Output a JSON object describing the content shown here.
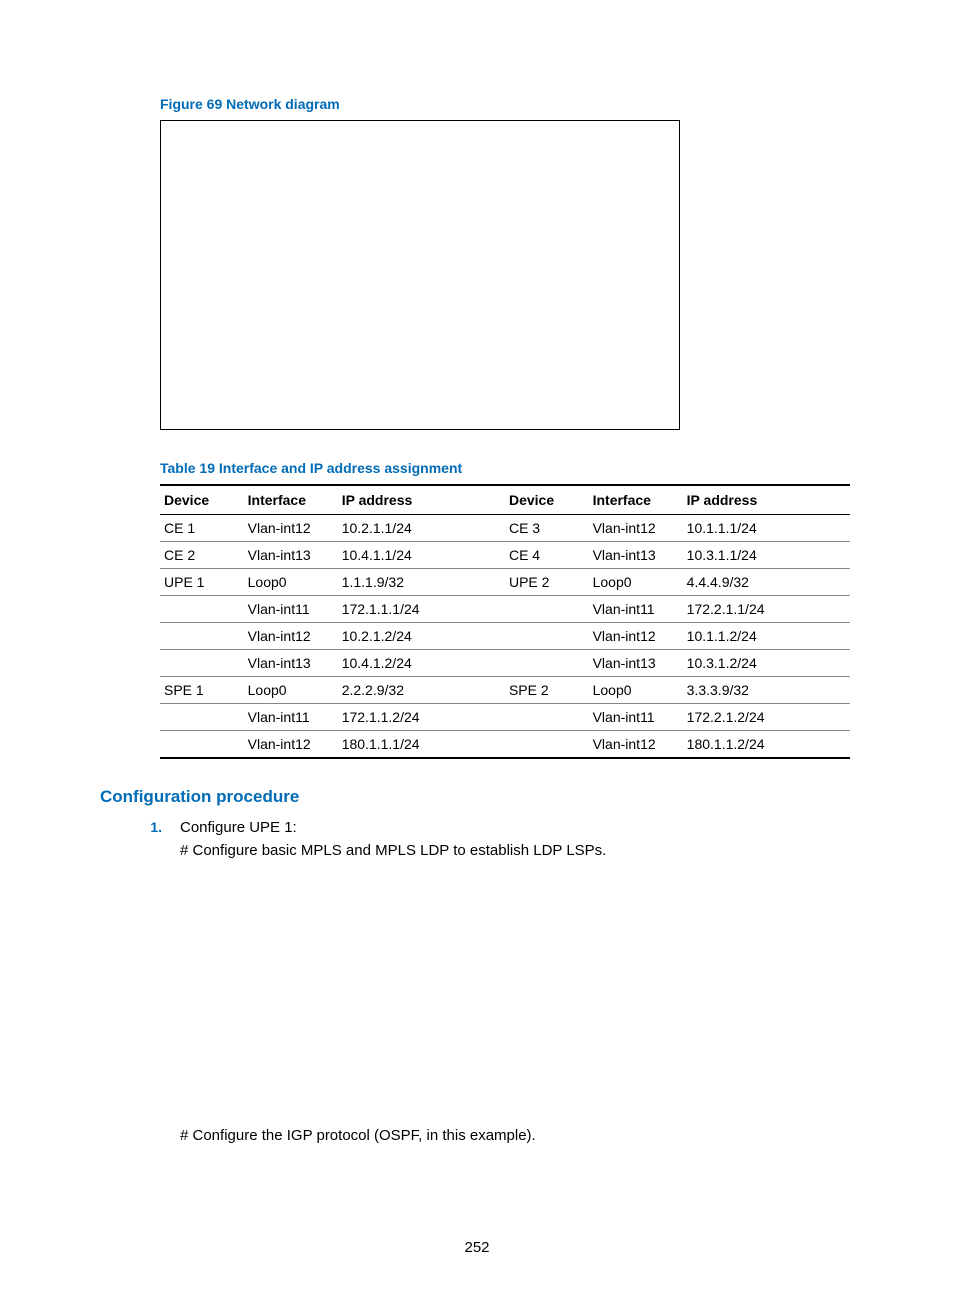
{
  "figure_caption": "Figure 69 Network diagram",
  "table_caption": "Table 19 Interface and IP address assignment",
  "table": {
    "headers": [
      "Device",
      "Interface",
      "IP address",
      "Device",
      "Interface",
      "IP address"
    ],
    "rows": [
      [
        "CE 1",
        "Vlan-int12",
        "10.2.1.1/24",
        "CE 3",
        "Vlan-int12",
        "10.1.1.1/24"
      ],
      [
        "CE 2",
        "Vlan-int13",
        "10.4.1.1/24",
        "CE 4",
        "Vlan-int13",
        "10.3.1.1/24"
      ],
      [
        "UPE 1",
        "Loop0",
        "1.1.1.9/32",
        "UPE 2",
        "Loop0",
        "4.4.4.9/32"
      ],
      [
        "",
        "Vlan-int11",
        "172.1.1.1/24",
        "",
        "Vlan-int11",
        "172.2.1.1/24"
      ],
      [
        "",
        "Vlan-int12",
        "10.2.1.2/24",
        "",
        "Vlan-int12",
        "10.1.1.2/24"
      ],
      [
        "",
        "Vlan-int13",
        "10.4.1.2/24",
        "",
        "Vlan-int13",
        "10.3.1.2/24"
      ],
      [
        "SPE 1",
        "Loop0",
        "2.2.2.9/32",
        "SPE 2",
        "Loop0",
        "3.3.3.9/32"
      ],
      [
        "",
        "Vlan-int11",
        "172.1.1.2/24",
        "",
        "Vlan-int11",
        "172.2.1.2/24"
      ],
      [
        "",
        "Vlan-int12",
        "180.1.1.1/24",
        "",
        "Vlan-int12",
        "180.1.1.2/24"
      ]
    ]
  },
  "section_heading": "Configuration procedure",
  "step1_number": "1.",
  "step1_text": "Configure UPE 1:",
  "hash_line_1": "# Configure basic MPLS and MPLS LDP to establish LDP LSPs.",
  "hash_line_2": "# Configure the IGP protocol (OSPF, in this example).",
  "page_number": "252"
}
